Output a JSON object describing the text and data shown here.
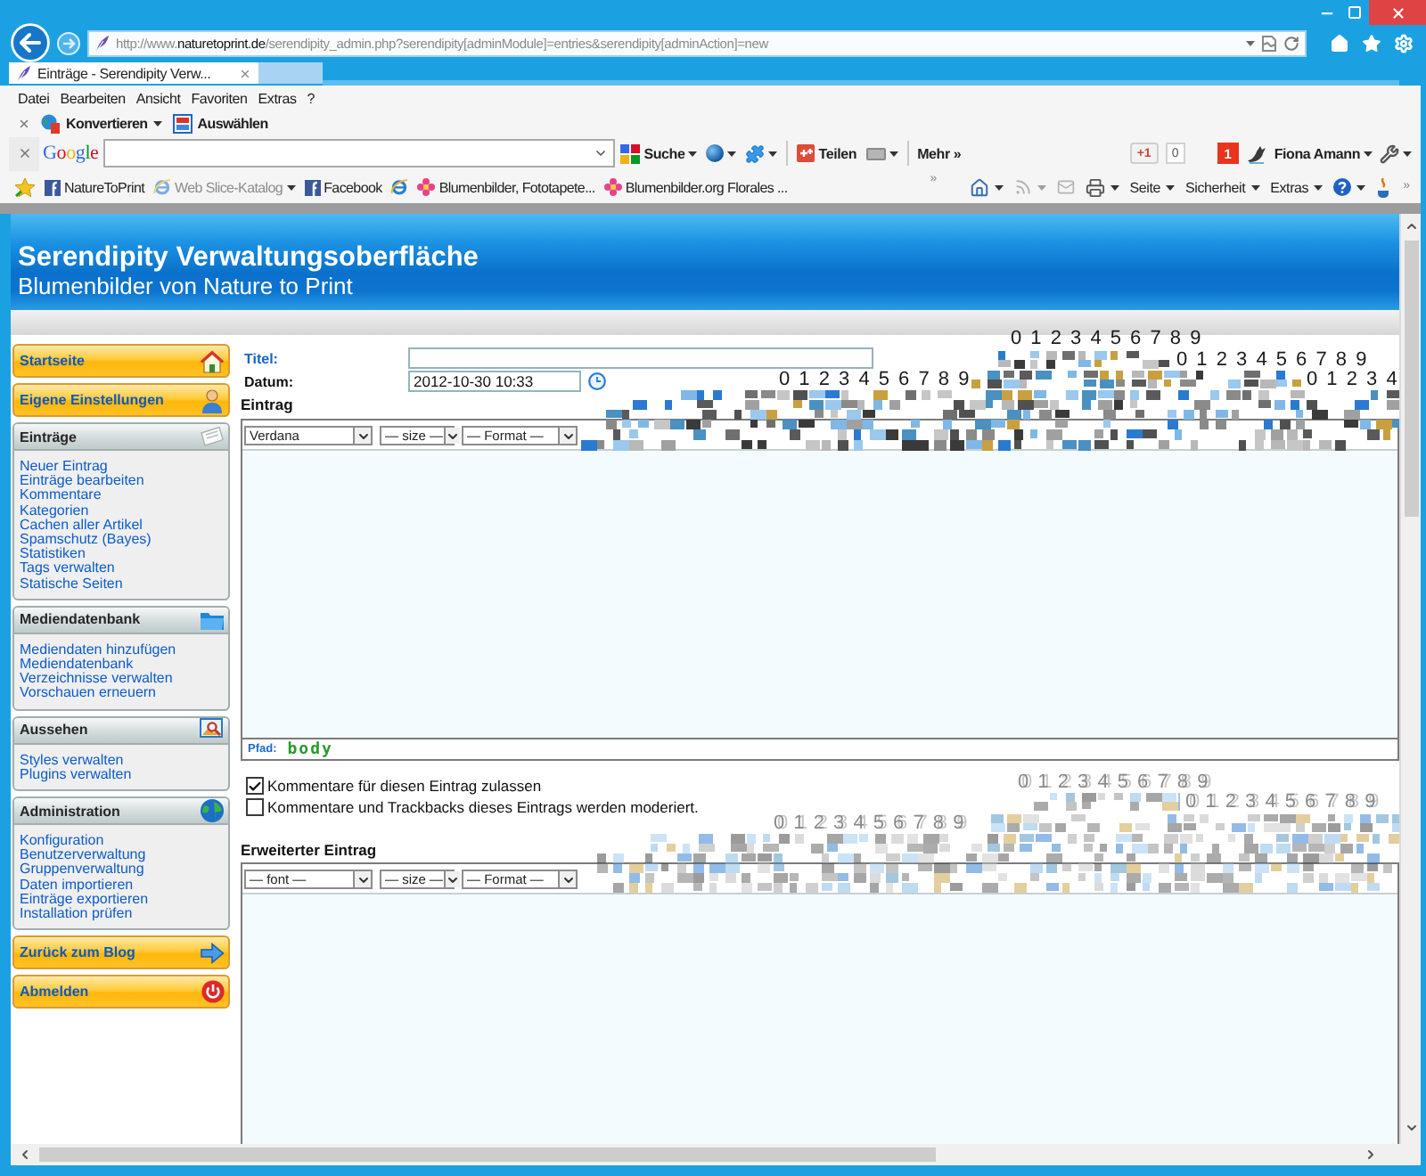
{
  "address_bar": {
    "url_prefix": "http://www.",
    "url_domain": "naturetoprint.de",
    "url_path": "/serendipity_admin.php?serendipity[adminModule]=entries&serendipity[adminAction]=new"
  },
  "tabs": [
    {
      "title": "Einträge - Serendipity Verw...",
      "selected": true
    }
  ],
  "menu_bar": [
    "Datei",
    "Bearbeiten",
    "Ansicht",
    "Favoriten",
    "Extras",
    "?"
  ],
  "converter_toolbar": [
    {
      "kind": "convert",
      "label": "Konvertieren",
      "dropdown": true
    },
    {
      "kind": "select",
      "label": "Auswählen",
      "dropdown": false
    }
  ],
  "google_toolbar": {
    "logo": "Google",
    "button_groups": [
      [
        {
          "kind": "search",
          "label": "Suche",
          "dropdown": true
        },
        {
          "kind": "globe",
          "dropdown": true
        },
        {
          "kind": "puzzle",
          "dropdown": true
        }
      ],
      [
        {
          "kind": "share",
          "label": "Teilen",
          "dropdown": false
        },
        {
          "kind": "keyboard",
          "dropdown": true
        }
      ],
      [
        {
          "kind": "more",
          "label": "Mehr",
          "glyph": "»",
          "dropdown": false
        }
      ]
    ],
    "plus_one": "+1",
    "share_count": "0",
    "notification_count": "1",
    "user_name": "Fiona Amann"
  },
  "favorites_bar": {
    "items": [
      {
        "kind": "facebook",
        "label": "NatureToPrint",
        "dropdown": false,
        "disabled": false
      },
      {
        "kind": "ie",
        "label": "Web Slice-Katalog",
        "dropdown": true,
        "disabled": true
      },
      {
        "kind": "facebook",
        "label": "Facebook",
        "dropdown": false,
        "disabled": false
      },
      {
        "kind": "ie",
        "dropdown": false,
        "disabled": false
      },
      {
        "kind": "flower",
        "label": "Blumenbilder, Fototapete...",
        "dropdown": false,
        "disabled": false
      },
      {
        "kind": "flower",
        "label": "Blumenbilder.org Florales ...",
        "dropdown": false,
        "disabled": false
      }
    ],
    "overflow": "»",
    "commands": [
      {
        "kind": "home",
        "dropdown": true,
        "disabled": false
      },
      {
        "kind": "rss",
        "dropdown": true,
        "disabled": true
      },
      {
        "kind": "mail",
        "dropdown": false,
        "disabled": true
      },
      {
        "kind": "print",
        "dropdown": true,
        "disabled": false
      },
      {
        "kind": "menu",
        "label": "Seite",
        "dropdown": true,
        "disabled": false
      },
      {
        "kind": "menu",
        "label": "Sicherheit",
        "dropdown": true,
        "disabled": false
      },
      {
        "kind": "menu",
        "label": "Extras",
        "dropdown": true,
        "disabled": false
      },
      {
        "kind": "help",
        "dropdown": true,
        "disabled": false
      },
      {
        "kind": "java",
        "dropdown": false,
        "disabled": false
      }
    ],
    "commands_overflow": "»"
  },
  "page": {
    "header": {
      "title": "Serendipity Verwaltungsoberfläche",
      "subtitle": "Blumenbilder von Nature to Print"
    },
    "sidebar": {
      "top_buttons": [
        {
          "kind": "home",
          "label": "Startseite"
        },
        {
          "kind": "user",
          "label": "Eigene Einstellungen"
        }
      ],
      "panels": [
        {
          "kind": "entries",
          "title": "Einträge",
          "links": [
            "Neuer Eintrag",
            "Einträge bearbeiten",
            "Kommentare",
            "Kategorien",
            "Cachen aller Artikel",
            "Spamschutz (Bayes)",
            "Statistiken",
            "Tags verwalten",
            "Statische Seiten"
          ]
        },
        {
          "kind": "media",
          "title": "Mediendatenbank",
          "links": [
            "Mediendaten hinzufügen",
            "Mediendatenbank",
            "Verzeichnisse verwalten",
            "Vorschauen erneuern"
          ]
        },
        {
          "kind": "appearance",
          "title": "Aussehen",
          "links": [
            "Styles verwalten",
            "Plugins verwalten"
          ]
        },
        {
          "kind": "admin",
          "title": "Administration",
          "links": [
            "Konfiguration",
            "Benutzerverwaltung",
            "Gruppenverwaltung",
            "Daten importieren",
            "Einträge exportieren",
            "Installation prüfen"
          ]
        }
      ],
      "bottom_buttons": [
        {
          "kind": "back",
          "label": "Zurück zum Blog"
        },
        {
          "kind": "logout",
          "label": "Abmelden"
        }
      ]
    },
    "form": {
      "title_label": "Titel:",
      "date_label": "Datum:",
      "date_value": "2012-10-30 10:33",
      "entry_label": "Eintrag",
      "entry_editor": {
        "selects": [
          "Verdana",
          "— size —",
          "— Format —"
        ],
        "path_label": "Pfad:",
        "path_value": "body"
      },
      "checkboxes": [
        {
          "label": "Kommentare für diesen Eintrag zulassen",
          "checked": true
        },
        {
          "label": "Kommentare und Trackbacks dieses Eintrags werden moderiert.",
          "checked": false
        }
      ],
      "extended_label": "Erweiterter Eintrag",
      "extended_editor": {
        "selects": [
          "— font —",
          "— size —",
          "— Format —"
        ]
      }
    },
    "render_glitch": {
      "digit_rows": [
        {
          "text": "0 1 2 3 4 5 6 7 8 9",
          "ghosted": false
        },
        {
          "text": "0 1 2 3 4 5 6 7 8 9",
          "ghosted": false
        },
        {
          "text": "0 1 2 3 4 5 6 7 8 9",
          "ghosted": false
        },
        {
          "text": "0 1 2 3 4",
          "ghosted": false
        },
        {
          "text": "0 1 2 3 4 5 6 7 8 9",
          "ghosted": true
        },
        {
          "text": "0 1 2 3 4 5 6 7 8 9",
          "ghosted": true
        },
        {
          "text": "0 1 2 3 4 5 6 7 8 9",
          "ghosted": true
        }
      ]
    }
  }
}
